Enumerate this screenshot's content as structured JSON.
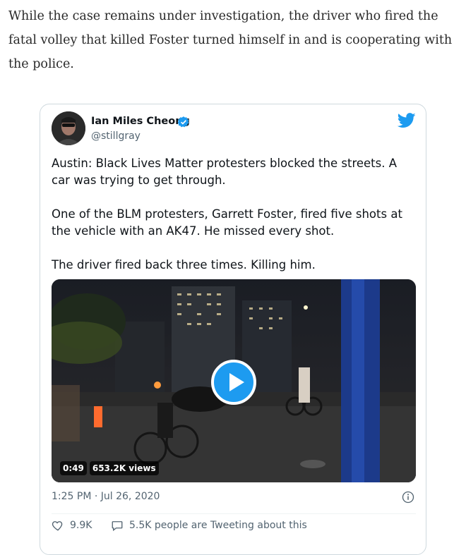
{
  "article": {
    "paragraph": "While the case remains under investigation, the driver who fired the fatal volley that killed Foster turned himself in and is cooperating with the police."
  },
  "tweet": {
    "author_name": "Ian Miles Cheong",
    "author_handle": "@stillgray",
    "paragraphs": [
      "Austin: Black Lives Matter protesters blocked the streets. A car was trying to get through.",
      "One of the BLM protesters, Garrett Foster, fired five shots at the vehicle with an AK47. He missed every shot.",
      "The driver fired back three times. Killing him."
    ],
    "video": {
      "duration": "0:49",
      "views": "653.2K views"
    },
    "timestamp": "1:25 PM · Jul 26, 2020",
    "likes": "9.9K",
    "replies_text": "5.5K people are Tweeting about this"
  },
  "colors": {
    "accent": "#1d9bf0",
    "text": "#0f1419",
    "muted": "#536471",
    "border": "#cfd9de"
  },
  "icons": [
    "verified-badge-icon",
    "twitter-bird-icon",
    "play-icon",
    "info-icon",
    "heart-icon",
    "speech-bubble-icon"
  ]
}
